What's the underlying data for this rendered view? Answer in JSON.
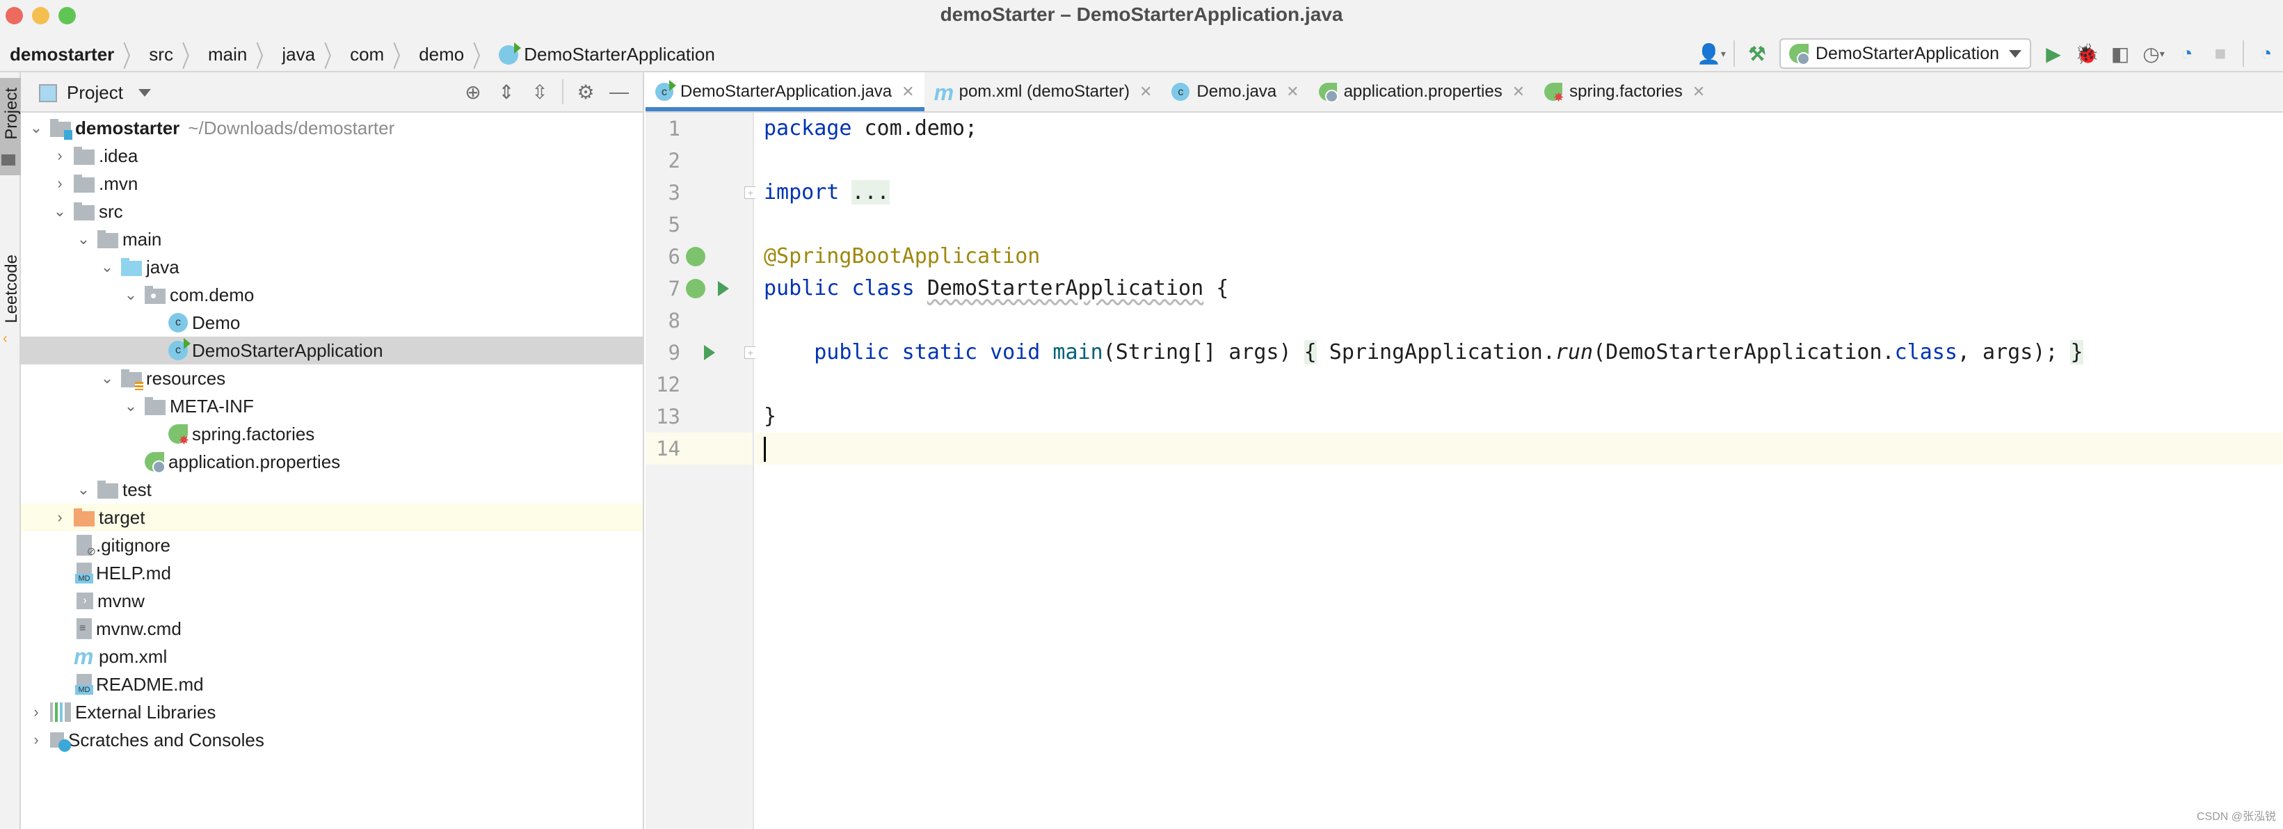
{
  "window": {
    "title": "demoStarter – DemoStarterApplication.java"
  },
  "breadcrumb": [
    "demostarter",
    "src",
    "main",
    "java",
    "com",
    "demo",
    "DemoStarterApplication"
  ],
  "toolbar": {
    "run_config": "DemoStarterApplication"
  },
  "left_strip": {
    "project_label": "Project",
    "leetcode_label": "Leetcode"
  },
  "project_panel": {
    "title": "Project",
    "tree": [
      {
        "label": "demostarter",
        "hint": "~/Downloads/demostarter",
        "depth": 0,
        "arrow": "open",
        "icon": "module-folder",
        "bold": true
      },
      {
        "label": ".idea",
        "depth": 1,
        "arrow": "closed",
        "icon": "folder"
      },
      {
        "label": ".mvn",
        "depth": 1,
        "arrow": "closed",
        "icon": "folder"
      },
      {
        "label": "src",
        "depth": 1,
        "arrow": "open",
        "icon": "folder"
      },
      {
        "label": "main",
        "depth": 2,
        "arrow": "open",
        "icon": "folder"
      },
      {
        "label": "java",
        "depth": 3,
        "arrow": "open",
        "icon": "source-folder"
      },
      {
        "label": "com.demo",
        "depth": 4,
        "arrow": "open",
        "icon": "package"
      },
      {
        "label": "Demo",
        "depth": 5,
        "arrow": "none",
        "icon": "class"
      },
      {
        "label": "DemoStarterApplication",
        "depth": 5,
        "arrow": "none",
        "icon": "app-class",
        "selected": true
      },
      {
        "label": "resources",
        "depth": 3,
        "arrow": "open",
        "icon": "resources-folder"
      },
      {
        "label": "META-INF",
        "depth": 4,
        "arrow": "open",
        "icon": "folder"
      },
      {
        "label": "spring.factories",
        "depth": 5,
        "arrow": "none",
        "icon": "spring-factories"
      },
      {
        "label": "application.properties",
        "depth": 4,
        "arrow": "none",
        "icon": "spring-properties"
      },
      {
        "label": "test",
        "depth": 2,
        "arrow": "open",
        "icon": "folder"
      },
      {
        "label": "target",
        "depth": 1,
        "arrow": "closed",
        "icon": "excluded-folder",
        "highlight": true
      },
      {
        "label": ".gitignore",
        "depth": 1,
        "arrow": "none",
        "icon": "gitignore-file"
      },
      {
        "label": "HELP.md",
        "depth": 1,
        "arrow": "none",
        "icon": "markdown-file"
      },
      {
        "label": "mvnw",
        "depth": 1,
        "arrow": "none",
        "icon": "shell-file"
      },
      {
        "label": "mvnw.cmd",
        "depth": 1,
        "arrow": "none",
        "icon": "cmd-file"
      },
      {
        "label": "pom.xml",
        "depth": 1,
        "arrow": "none",
        "icon": "maven-file"
      },
      {
        "label": "README.md",
        "depth": 1,
        "arrow": "none",
        "icon": "markdown-file"
      },
      {
        "label": "External Libraries",
        "depth": 0,
        "arrow": "closed",
        "icon": "libraries"
      },
      {
        "label": "Scratches and Consoles",
        "depth": 0,
        "arrow": "closed",
        "icon": "scratches"
      }
    ]
  },
  "editor": {
    "tabs": [
      {
        "label": "DemoStarterApplication.java",
        "icon": "app-class",
        "active": true
      },
      {
        "label": "pom.xml (demoStarter)",
        "icon": "maven-file"
      },
      {
        "label": "Demo.java",
        "icon": "class"
      },
      {
        "label": "application.properties",
        "icon": "spring-properties"
      },
      {
        "label": "spring.factories",
        "icon": "spring-factories"
      }
    ],
    "line_numbers": [
      "1",
      "2",
      "3",
      "5",
      "6",
      "7",
      "8",
      "9",
      "12",
      "13",
      "14"
    ],
    "code": {
      "l1_kw": "package",
      "l1_rest": " com.demo;",
      "l3_kw": "import",
      "l3_fold": "...",
      "l6_ann": "@SpringBootApplication",
      "l7_kw1": "public",
      "l7_kw2": "class",
      "l7_name": "DemoStarterApplication",
      "l7_rest": " {",
      "l9_kw": "public static void",
      "l9_fn": "main",
      "l9_params": "(String[] args)",
      "l9_open": "{",
      "l9_call": " SpringApplication.",
      "l9_run": "run",
      "l9_args1": "(DemoStarterApplication.",
      "l9_cls": "class",
      "l9_args2": ", args);",
      "l9_close": "}",
      "l13": "}"
    }
  },
  "watermark": "CSDN @张泓锐"
}
